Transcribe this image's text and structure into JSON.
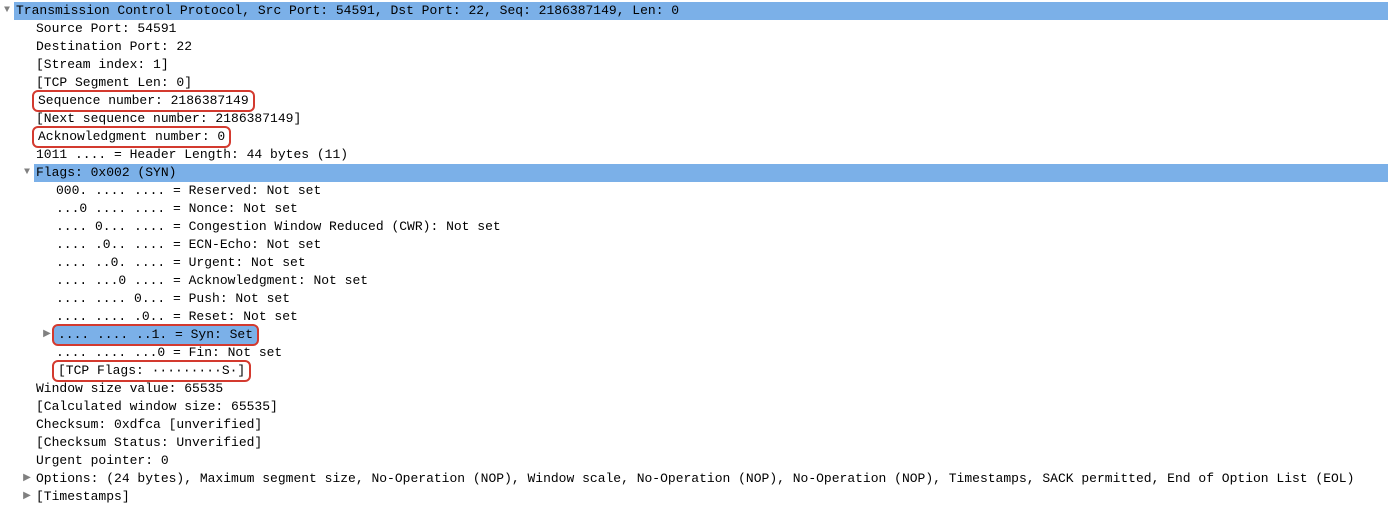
{
  "arrows": {
    "down": "▼",
    "right": "▶"
  },
  "colors": {
    "selection": "#7bb0e8",
    "annotation": "#d33a2f"
  },
  "tcp": {
    "header": "Transmission Control Protocol, Src Port: 54591, Dst Port: 22, Seq: 2186387149, Len: 0",
    "src_port": "Source Port: 54591",
    "dst_port": "Destination Port: 22",
    "stream_index": "[Stream index: 1]",
    "seg_len": "[TCP Segment Len: 0]",
    "seq_num": "Sequence number: 2186387149",
    "next_seq": "[Next sequence number: 2186387149]",
    "ack_num": "Acknowledgment number: 0",
    "hdr_len": "1011 .... = Header Length: 44 bytes (11)",
    "flags_header": "Flags: 0x002 (SYN)",
    "flags": {
      "reserved": "000. .... .... = Reserved: Not set",
      "nonce": "...0 .... .... = Nonce: Not set",
      "cwr": ".... 0... .... = Congestion Window Reduced (CWR): Not set",
      "ecn": ".... .0.. .... = ECN-Echo: Not set",
      "urg": ".... ..0. .... = Urgent: Not set",
      "ack": ".... ...0 .... = Acknowledgment: Not set",
      "psh": ".... .... 0... = Push: Not set",
      "rst": ".... .... .0.. = Reset: Not set",
      "syn": ".... .... ..1. = Syn: Set",
      "fin": ".... .... ...0 = Fin: Not set",
      "summary": "[TCP Flags: ·········S·]"
    },
    "win_size": "Window size value: 65535",
    "calc_win": "[Calculated window size: 65535]",
    "checksum": "Checksum: 0xdfca [unverified]",
    "checksum_status": "[Checksum Status: Unverified]",
    "urg_ptr": "Urgent pointer: 0",
    "options": "Options: (24 bytes), Maximum segment size, No-Operation (NOP), Window scale, No-Operation (NOP), No-Operation (NOP), Timestamps, SACK permitted, End of Option List (EOL)",
    "timestamps": "[Timestamps]"
  }
}
